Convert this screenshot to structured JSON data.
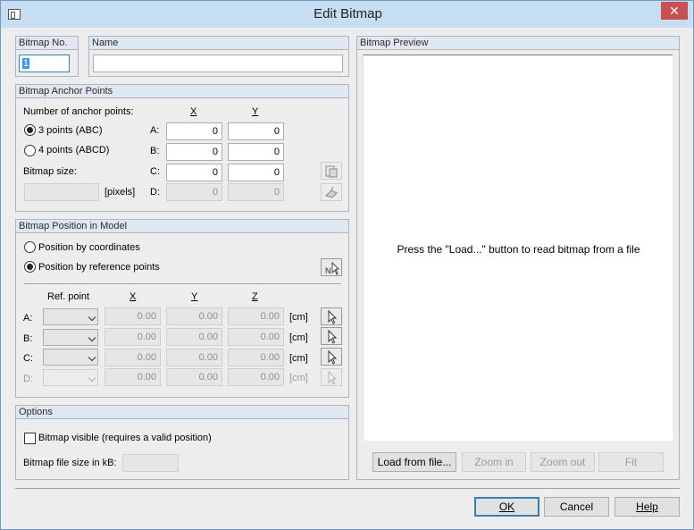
{
  "window": {
    "title": "Edit Bitmap",
    "close_label": "✕"
  },
  "bitmap_no": {
    "header": "Bitmap No.",
    "value": "1"
  },
  "name": {
    "header": "Name",
    "value": ""
  },
  "anchor": {
    "header": "Bitmap Anchor Points",
    "count_label": "Number of anchor points:",
    "col_x": "X",
    "col_y": "Y",
    "option_3": "3 points (ABC)",
    "option_4": "4 points (ABCD)",
    "size_label": "Bitmap size:",
    "size_value": "",
    "pixels_label": "[pixels]",
    "rows": [
      {
        "label": "A:",
        "x": "0",
        "y": "0"
      },
      {
        "label": "B:",
        "x": "0",
        "y": "0"
      },
      {
        "label": "C:",
        "x": "0",
        "y": "0"
      },
      {
        "label": "D:",
        "x": "0",
        "y": "0"
      }
    ]
  },
  "position": {
    "header": "Bitmap Position in Model",
    "by_coords": "Position by coordinates",
    "by_refpoints": "Position by reference points",
    "col_ref": "Ref. point",
    "col_x": "X",
    "col_y": "Y",
    "col_z": "Z",
    "rows": [
      {
        "label": "A:",
        "x": "0.00",
        "y": "0.00",
        "z": "0.00",
        "unit": "[cm]"
      },
      {
        "label": "B:",
        "x": "0.00",
        "y": "0.00",
        "z": "0.00",
        "unit": "[cm]"
      },
      {
        "label": "C:",
        "x": "0.00",
        "y": "0.00",
        "z": "0.00",
        "unit": "[cm]"
      },
      {
        "label": "D:",
        "x": "0.00",
        "y": "0.00",
        "z": "0.00",
        "unit": "[cm]"
      }
    ]
  },
  "options": {
    "header": "Options",
    "visible_label": "Bitmap visible (requires a valid position)",
    "filesize_label": "Bitmap file size in kB:",
    "filesize_value": ""
  },
  "preview": {
    "header": "Bitmap Preview",
    "message": "Press the \"Load...\" button to read bitmap from a file",
    "load_label": "Load from file...",
    "zoom_in_label": "Zoom in",
    "zoom_out_label": "Zoom out",
    "fit_label": "Fit"
  },
  "buttons": {
    "ok": "OK",
    "cancel": "Cancel",
    "help": "Help"
  }
}
